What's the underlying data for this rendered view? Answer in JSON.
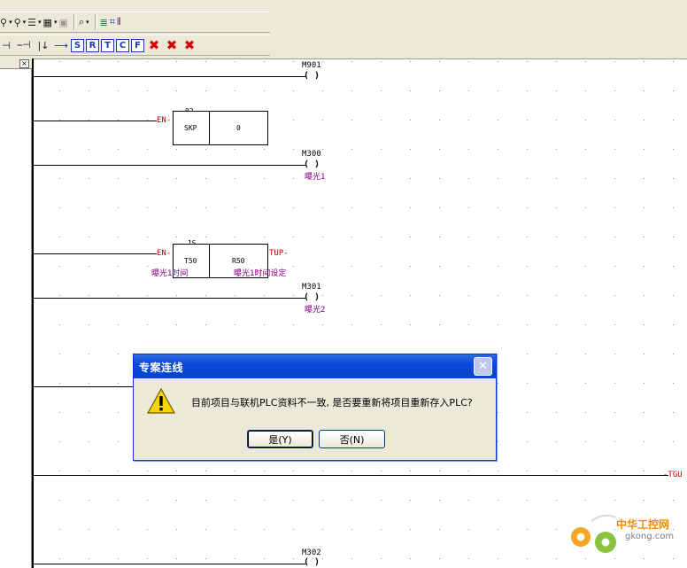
{
  "toolbar": {
    "row1": [
      {
        "name": "zoom-search-icon",
        "glyph": "⚲"
      },
      {
        "name": "device-search-icon",
        "glyph": "⚲"
      },
      {
        "name": "list-tool-icon",
        "glyph": "☰"
      },
      {
        "name": "register-tool-icon",
        "glyph": "▦"
      },
      {
        "name": "calculator-icon",
        "glyph": "▣"
      },
      {
        "name": "monitor-icon",
        "glyph": "⌕"
      },
      {
        "name": "table-icon",
        "glyph": "≣"
      },
      {
        "name": "comment-icon",
        "glyph": "⌗"
      },
      {
        "name": "contact-icon",
        "glyph": "⫴"
      }
    ],
    "row2_letters": [
      "S",
      "R",
      "T",
      "C",
      "F"
    ],
    "row2_delete": [
      "✖",
      "✖",
      "✖"
    ]
  },
  "ladder": {
    "rung1_coil": "M901",
    "rung2_en": "EN",
    "rung2_block_top": "02",
    "rung2_block_op": "SKP",
    "rung2_block_val": "0",
    "rung3_coil": "M300",
    "rung3_comment": "曝光1",
    "rung4_en": "EN",
    "rung4_block_top": ".1S",
    "rung4_block_op": "T50",
    "rung4_block_val": "R50",
    "rung4_tup": "TUP",
    "rung4_c1": "曝光1时间",
    "rung4_c2": "曝光1时间设定",
    "rung5_coil": "M301",
    "rung5_comment": "曝光2",
    "rung6_right": "TGU",
    "rung7_coil": "M302",
    "coil_symbol": "( )"
  },
  "dialog": {
    "title": "专案连线",
    "message": "目前项目与联机PLC资料不一致, 是否要重新将项目重新存入PLC?",
    "yes_label": "是(Y)",
    "no_label": "否(N)"
  },
  "watermark": {
    "text": "中华工控网",
    "url": "gkong.com"
  },
  "colors": {
    "dialog_title": "#0a49d8",
    "label_red": "#c00000",
    "comment_purple": "#800080"
  }
}
